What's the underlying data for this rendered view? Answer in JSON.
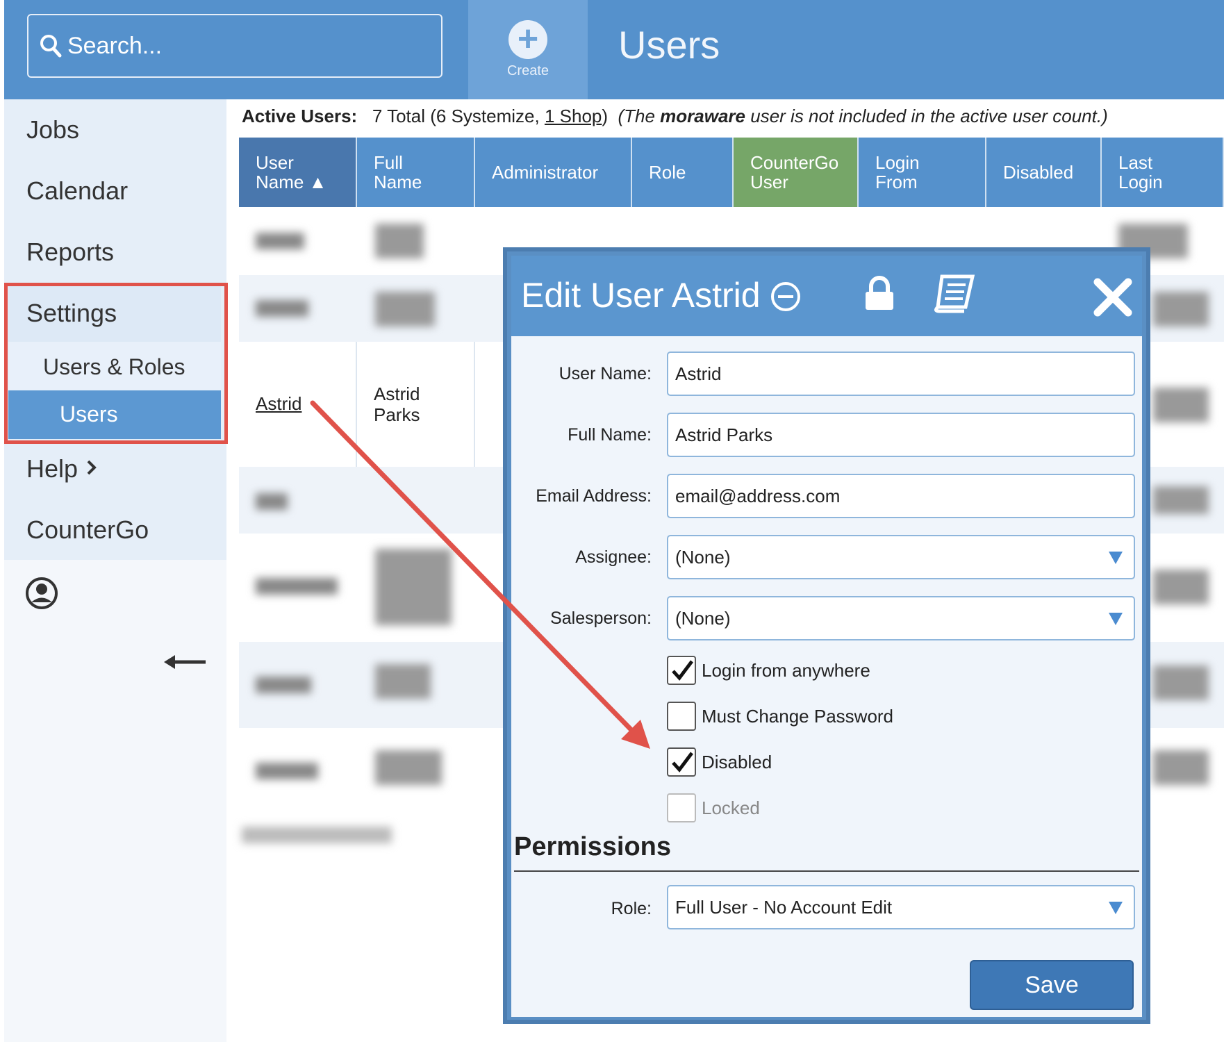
{
  "search": {
    "placeholder": "Search..."
  },
  "create": {
    "label": "Create"
  },
  "page_title": "Users",
  "sidebar": {
    "items": [
      "Jobs",
      "Calendar",
      "Reports",
      "Settings",
      "Help",
      "CounterGo"
    ],
    "settings_sub": {
      "users_roles": "Users & Roles",
      "users": "Users"
    }
  },
  "active_users": {
    "label": "Active Users:",
    "text1": "7 Total (6 Systemize, ",
    "shop_link": "1 Shop",
    "text2": ")",
    "note_pre": "(The ",
    "note_bold": "moraware",
    "note_post": " user is not included in the active user count.)"
  },
  "table": {
    "headers": [
      {
        "l1": "User",
        "l2": "Name ▲"
      },
      {
        "l1": "Full",
        "l2": "Name"
      },
      {
        "l1": "Administrator",
        "l2": ""
      },
      {
        "l1": "Role",
        "l2": ""
      },
      {
        "l1": "CounterGo",
        "l2": "User"
      },
      {
        "l1": "Login",
        "l2": "From"
      },
      {
        "l1": "Disabled",
        "l2": ""
      },
      {
        "l1": "Last",
        "l2": "Login"
      }
    ],
    "astrid_row": {
      "user": "Astrid",
      "full_1": "Astrid",
      "full_2": "Parks"
    }
  },
  "dialog": {
    "title": "Edit User Astrid",
    "user_name_label": "User Name:",
    "user_name": "Astrid",
    "full_name_label": "Full Name:",
    "full_name": "Astrid Parks",
    "email_label": "Email Address:",
    "email": "email@address.com",
    "assignee_label": "Assignee:",
    "assignee": "(None)",
    "salesperson_label": "Salesperson:",
    "salesperson": "(None)",
    "login_anywhere": "Login from anywhere",
    "must_change": "Must Change Password",
    "disabled": "Disabled",
    "locked": "Locked",
    "permissions": "Permissions",
    "role_label": "Role:",
    "role": "Full User - No Account Edit",
    "save": "Save",
    "checks": {
      "login_anywhere": true,
      "must_change": false,
      "disabled": true,
      "locked": false
    }
  },
  "colors": {
    "header_blue": "#5591cc",
    "counterego_green": "#76a668",
    "highlight_red": "#e0524a"
  }
}
